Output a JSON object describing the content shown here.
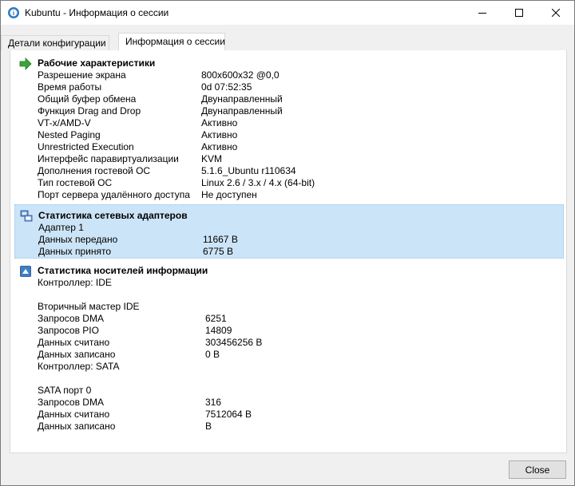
{
  "window": {
    "title": "Kubuntu - Информация о сессии"
  },
  "tabs": [
    {
      "label": "Детали конфигурации"
    },
    {
      "label": "Информация о сессии"
    }
  ],
  "runtime": {
    "heading": "Рабочие характеристики",
    "rows": [
      {
        "key": "Разрешение экрана",
        "value": "800x600x32 @0,0"
      },
      {
        "key": "Время работы",
        "value": "0d 07:52:35"
      },
      {
        "key": "Общий буфер обмена",
        "value": "Двунаправленный"
      },
      {
        "key": "Функция Drag and Drop",
        "value": "Двунаправленный"
      },
      {
        "key": "VT-x/AMD-V",
        "value": "Активно"
      },
      {
        "key": "Nested Paging",
        "value": "Активно"
      },
      {
        "key": "Unrestricted Execution",
        "value": "Активно"
      },
      {
        "key": "Интерфейс паравиртуализации",
        "value": "KVM"
      },
      {
        "key": "Дополнения гостевой ОС",
        "value": "5.1.6_Ubuntu r110634"
      },
      {
        "key": "Тип гостевой ОС",
        "value": "Linux 2.6 / 3.x / 4.x (64-bit)"
      },
      {
        "key": "Порт сервера удалённого доступа",
        "value": "Не доступен"
      }
    ]
  },
  "network": {
    "heading": "Статистика сетевых адаптеров",
    "adapter": "Адаптер 1",
    "rows": [
      {
        "key": "Данных передано",
        "value": "11667 B"
      },
      {
        "key": "Данных принято",
        "value": "6775 B"
      }
    ]
  },
  "storage": {
    "heading": "Статистика носителей информации",
    "ide_controller": "Контроллер: IDE",
    "ide_device": "Вторичный мастер IDE",
    "ide_rows": [
      {
        "key": "Запросов DMA",
        "value": "6251"
      },
      {
        "key": "Запросов PIO",
        "value": "14809"
      },
      {
        "key": "Данных считано",
        "value": "303456256 B"
      },
      {
        "key": "Данных записано",
        "value": "0 B"
      }
    ],
    "sata_controller": "Контроллер: SATA",
    "sata_device": "SATA порт 0",
    "sata_rows": [
      {
        "key": "Запросов DMA",
        "value": "316"
      },
      {
        "key": "Данных считано",
        "value": "7512064 B"
      },
      {
        "key": "Данных записано",
        "value": "B"
      }
    ]
  },
  "buttons": {
    "close": "Close"
  },
  "icons": {
    "app": "virtualbox-icon",
    "runtime": "green-arrow-icon",
    "network": "network-adapter-icon",
    "storage": "storage-icon"
  },
  "colors": {
    "selection": "#cce4f7",
    "selection_border": "#99c9ef"
  }
}
